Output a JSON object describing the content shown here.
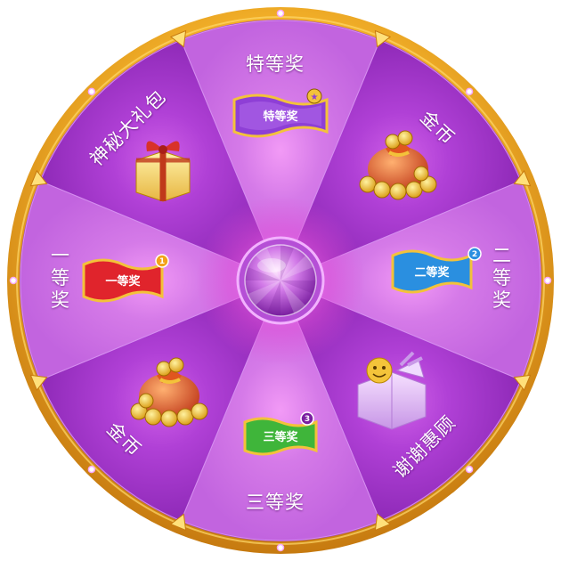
{
  "wheel": {
    "segments": [
      {
        "label": "特等奖",
        "prize": "特等奖",
        "badge": ""
      },
      {
        "label": "金币",
        "prize": "",
        "badge": ""
      },
      {
        "label": "二等奖",
        "prize": "二等奖",
        "badge": "2"
      },
      {
        "label": "谢谢惠顾",
        "prize": "",
        "badge": ""
      },
      {
        "label": "三等奖",
        "prize": "三等奖",
        "badge": "3"
      },
      {
        "label": "金币",
        "prize": "",
        "badge": ""
      },
      {
        "label": "一等奖",
        "prize": "一等奖",
        "badge": "1"
      },
      {
        "label": "神秘大礼包",
        "prize": "",
        "badge": ""
      }
    ]
  },
  "colors": {
    "rim_gold": "#f5b32a",
    "rim_purple": "#7a1fa0",
    "segment_light": "#c85ee0",
    "segment_dark": "#9a2fc0",
    "flag_special": "#8e3fd6",
    "flag_first": "#e0242c",
    "flag_second": "#2a8fe0",
    "flag_third": "#3fb53a"
  },
  "icons": [
    "gold-coins-bag-icon",
    "smiley-gift-box-icon",
    "gift-box-icon",
    "wheel-center-button-icon"
  ]
}
